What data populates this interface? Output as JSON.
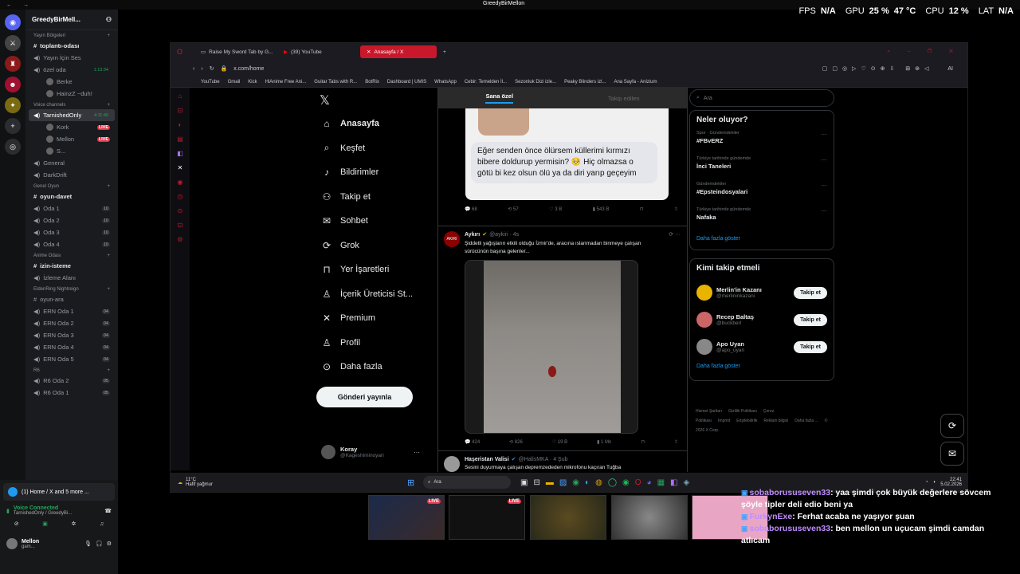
{
  "window_title": "GreedyBirMellon",
  "stats": {
    "fps_label": "FPS",
    "fps_value": "N/A",
    "gpu_label": "GPU",
    "gpu_value": "25 %",
    "gpu_temp": "47 °C",
    "cpu_label": "CPU",
    "cpu_value": "12 %",
    "lat_label": "LAT",
    "lat_value": "N/A"
  },
  "discord": {
    "server_name": "GreedyBirMell...",
    "sections": [
      {
        "category": "Yayın Bölgeleri",
        "channels": [
          {
            "name": "toplantı-odası",
            "type": "text",
            "bright": true
          },
          {
            "name": "Yayın İçin Ses",
            "type": "voice"
          },
          {
            "name": "özel oda",
            "type": "voice",
            "time": "1:13:34"
          }
        ]
      },
      {
        "category": "Voice channels",
        "channels": [
          {
            "name": "TarnishedOnly",
            "type": "voice",
            "time": "4:11:40",
            "selected": true
          },
          {
            "name": "General",
            "type": "voice"
          },
          {
            "name": "DarkDrift",
            "type": "voice"
          }
        ]
      },
      {
        "category": "Genel Oyun",
        "channels": [
          {
            "name": "oyun-davet",
            "type": "text",
            "bright": true
          },
          {
            "name": "Oda 1",
            "type": "voice",
            "count": "10"
          },
          {
            "name": "Oda 2",
            "type": "voice",
            "count": "10"
          },
          {
            "name": "Oda 3",
            "type": "voice",
            "count": "10"
          },
          {
            "name": "Oda 4",
            "type": "voice",
            "count": "10"
          }
        ]
      },
      {
        "category": "Anime Odası",
        "channels": [
          {
            "name": "izin-isteme",
            "type": "text",
            "bright": true
          },
          {
            "name": "İzleme Alanı",
            "type": "voice"
          }
        ]
      },
      {
        "category": "EldenRing Nightreign",
        "channels": [
          {
            "name": "oyun-ara",
            "type": "text"
          },
          {
            "name": "ERN Oda 1",
            "type": "voice",
            "count": "04"
          },
          {
            "name": "ERN Oda 2",
            "type": "voice",
            "count": "04"
          },
          {
            "name": "ERN Oda 3",
            "type": "voice",
            "count": "04"
          },
          {
            "name": "ERN Oda 4",
            "type": "voice",
            "count": "04"
          },
          {
            "name": "ERN Oda 5",
            "type": "voice",
            "count": "04"
          }
        ]
      },
      {
        "category": "R6",
        "channels": [
          {
            "name": "R6 Oda 2",
            "type": "voice",
            "count": "05"
          },
          {
            "name": "R6 Oda 1",
            "type": "voice",
            "count": "05"
          }
        ]
      }
    ],
    "users_ozel": [
      "Berke",
      "HainzZ ~duh!"
    ],
    "users_tarnished": [
      {
        "name": "Kork",
        "live": "LIVE"
      },
      {
        "name": "Mellon",
        "live": "LIVE"
      },
      {
        "name": "S...",
        "live": ""
      }
    ],
    "bottom": {
      "activity": "(1) Home / X and 5 more ...",
      "voice_status": "Voice Connected",
      "voice_channel": "TarnishedOnly / GreedyBi...",
      "username": "Mellon",
      "user_status": "gam..."
    }
  },
  "browser": {
    "tabs": [
      {
        "label": "Raise My Sword Tab by G..."
      },
      {
        "label": "(39) YouTube"
      },
      {
        "label": "Anasayfa / X",
        "active": true
      }
    ],
    "url": "x.com/home",
    "bookmarks": [
      "YouTube",
      "Gmail",
      "Kick",
      "HiAnime Free Ani...",
      "Guitar Tabs with R...",
      "BotRix",
      "Dashboard | UMIS",
      "WhatsApp",
      "Cebir: Temelden İl...",
      "Sezonluk Dizi izle...",
      "Peaky Blinders izl...",
      "Ana Sayfa - Anizium"
    ],
    "ai_label": "AI"
  },
  "x": {
    "nav": [
      {
        "label": "Anasayfa",
        "icon": "home-icon",
        "bold": true
      },
      {
        "label": "Keşfet",
        "icon": "search-icon"
      },
      {
        "label": "Bildirimler",
        "icon": "bell-icon"
      },
      {
        "label": "Takip et",
        "icon": "person-add-icon"
      },
      {
        "label": "Sohbet",
        "icon": "mail-icon"
      },
      {
        "label": "Grok",
        "icon": "grok-icon"
      },
      {
        "label": "Yer İşaretleri",
        "icon": "bookmark-icon"
      },
      {
        "label": "İçerik Üreticisi St...",
        "icon": "creator-icon"
      },
      {
        "label": "Premium",
        "icon": "x-icon"
      },
      {
        "label": "Profil",
        "icon": "profile-icon"
      },
      {
        "label": "Daha fazla",
        "icon": "more-icon"
      }
    ],
    "post_button": "Gönderi yayınla",
    "account": {
      "name": "Koray",
      "handle": "@Kageshiminoyari"
    },
    "timeline_tabs": [
      "Sana özel",
      "Takip edilen"
    ],
    "tweet1": {
      "text": "Eğer senden önce ölürsem küllerimi kırmızı bibere doldurup yermisin? 🥺 Hiç olmazsa o götü bi kez olsun ölü ya da diri yarıp geçeyim",
      "replies": "68",
      "retweets": "57",
      "likes": "3 B",
      "views": "543 B"
    },
    "tweet2": {
      "name": "Aykırı",
      "handle": "@aykiri · 4s",
      "text": "Şiddetli yağışların etkili olduğu İzmir'de, aracına ıslanmadan binmeye çalışan sürücünün başına gelenler...",
      "replies": "424",
      "retweets": "826",
      "likes": "19 B",
      "views": "1 Mn"
    },
    "tweet3": {
      "name": "Haşeristan Valisi",
      "handle": "@HalisMKA · 4 Şub",
      "text": "Sesini duyurmaya çalışan depremzededen mikrofonu kaçıran Tuğba"
    },
    "search_placeholder": "Ara",
    "trends_title": "Neler oluyor?",
    "trends": [
      {
        "meta": "Spor · Gündemdekiler",
        "name": "#FBvERZ"
      },
      {
        "meta": "Türkiye tarihinde gündemde",
        "name": "İnci Taneleri"
      },
      {
        "meta": "Gündemdekiler",
        "name": "#Epsteindosyalari"
      },
      {
        "meta": "Türkiye tarihinde gündemde",
        "name": "Nafaka"
      }
    ],
    "show_more": "Daha fazla göster",
    "who_title": "Kimi takip etmeli",
    "who": [
      {
        "name": "Merlin'in Kazanı",
        "handle": "@merlininkazani",
        "button": "Takip et"
      },
      {
        "name": "Recep Baltaş",
        "handle": "@buckberl",
        "button": "Takip et"
      },
      {
        "name": "Apo Uyan",
        "handle": "@apo_uyan",
        "button": "Takip et"
      }
    ],
    "footer": [
      "Hizmet Şartları",
      "Gizlilik Politikası",
      "Çerez Politikası",
      "Imprint",
      "Erişilebilirlik",
      "Reklam bilgisi",
      "Daha fazla ...",
      "© 2026 X Corp."
    ]
  },
  "taskbar": {
    "weather_temp": "11°C",
    "weather_text": "Hafif yağmur",
    "search": "Ara",
    "time": "22:41",
    "date": "5.02.2026"
  },
  "live_label": "LIVE",
  "chat": [
    {
      "user": "sobaborususeven33",
      "msg": ": yaa şimdi çok büyük değerlere sövcem şöyle tipler deli edio beni ya"
    },
    {
      "user": "FurkynExe",
      "msg": ": Ferhat acaba ne yaşıyor şuan"
    },
    {
      "user": "sobaborususeven33",
      "msg": ": ben mellon un uçucam şimdi camdan atlıcam"
    }
  ]
}
